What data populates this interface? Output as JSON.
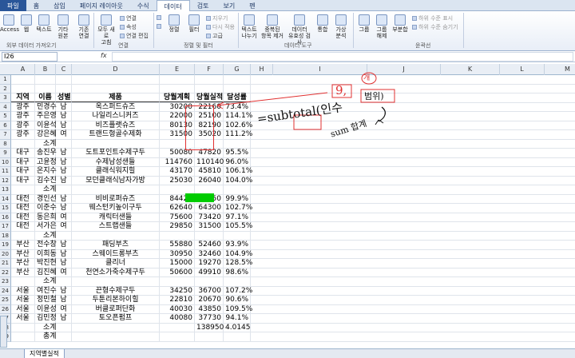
{
  "ribbon": {
    "tabs": [
      "파일",
      "홈",
      "삽입",
      "페이지 레이아웃",
      "수식",
      "데이터",
      "검토",
      "보기",
      "펜"
    ],
    "active_tab": "데이터",
    "buttons": {
      "access": "Access",
      "web": "웹",
      "text": "텍스트",
      "other_sources": "기타\n원본",
      "existing_conn": "기존\n연결",
      "refresh_all": "모두 새로\n고침",
      "conn": "연결",
      "props": "속성",
      "edit_links": "연결 편집",
      "sort_asc": "",
      "sort": "정렬",
      "filter": "필터",
      "clear": "지우기",
      "reapply": "다시 적용",
      "advanced": "고급",
      "text_to_cols": "텍스트\n나누기",
      "remove_dup": "중복된\n항목 제거",
      "validation": "데이터\n유효성 검사",
      "consolidate": "통합",
      "whatif": "가상\n분석",
      "group": "그룹",
      "ungroup": "그룹\n해제",
      "subtotal": "부분합",
      "show_detail": "하위 수준 표시",
      "hide_detail": "하위 수준 숨기기"
    },
    "groups": {
      "external": "외부 데이터 가져오기",
      "connections": "연결",
      "sortfilter": "정렬 및 필터",
      "datatools": "데이터 도구",
      "outline": "윤곽선"
    }
  },
  "formula_bar": {
    "name_box": "I26",
    "fx": "fx",
    "formula": ""
  },
  "columns": [
    "A",
    "B",
    "C",
    "D",
    "E",
    "F",
    "G",
    "H",
    "I",
    "J",
    "K",
    "L",
    "M",
    "N"
  ],
  "rows": [
    {
      "n": "1",
      "c": [
        "",
        "",
        "",
        "",
        "",
        "",
        ""
      ]
    },
    {
      "n": "2",
      "c": [
        "",
        "",
        "",
        "",
        "",
        "",
        ""
      ]
    },
    {
      "n": "3",
      "c": [
        "지역",
        "이름",
        "성별",
        "제품",
        "당월계획",
        "당월실적",
        "달성률"
      ]
    },
    {
      "n": "4",
      "c": [
        "광주",
        "민경수",
        "남",
        "옥스퍼드슈즈",
        "30200",
        "22160",
        "73.4%"
      ]
    },
    {
      "n": "5",
      "c": [
        "광주",
        "주은영",
        "남",
        "나일리스니커즈",
        "22000",
        "25100",
        "114.1%"
      ]
    },
    {
      "n": "6",
      "c": [
        "광주",
        "이윤석",
        "남",
        "비즈플랫슈즈",
        "80130",
        "82190",
        "102.6%"
      ]
    },
    {
      "n": "7",
      "c": [
        "광주",
        "강은혜",
        "여",
        "트랜드형골수제화",
        "31500",
        "35020",
        "111.2%"
      ]
    },
    {
      "n": "8",
      "c": [
        "",
        "소계",
        "",
        "",
        "",
        "",
        ""
      ]
    },
    {
      "n": "9",
      "c": [
        "대구",
        "송진우",
        "남",
        "도트포인트수제구두",
        "50080",
        "47820",
        "95.5%"
      ]
    },
    {
      "n": "10",
      "c": [
        "대구",
        "고윤정",
        "남",
        "수제남성샌들",
        "114760",
        "110140",
        "96.0%"
      ]
    },
    {
      "n": "11",
      "c": [
        "대구",
        "온지수",
        "남",
        "클래식워지힐",
        "43170",
        "45810",
        "106.1%"
      ]
    },
    {
      "n": "12",
      "c": [
        "대구",
        "김수진",
        "남",
        "모던클래식남자가방",
        "25030",
        "26040",
        "104.0%"
      ]
    },
    {
      "n": "13",
      "c": [
        "",
        "소계",
        "",
        "",
        "",
        "",
        ""
      ]
    },
    {
      "n": "14",
      "c": [
        "대전",
        "경인선",
        "남",
        "비비로퍼슈즈",
        "84420",
        "84350",
        "99.9%"
      ]
    },
    {
      "n": "15",
      "c": [
        "대전",
        "이준수",
        "남",
        "웨스턴키높이구두",
        "62640",
        "64300",
        "102.7%"
      ]
    },
    {
      "n": "16",
      "c": [
        "대전",
        "동은희",
        "여",
        "캐릭터샌들",
        "75600",
        "73420",
        "97.1%"
      ]
    },
    {
      "n": "17",
      "c": [
        "대전",
        "서가은",
        "여",
        "스트랩샌들",
        "29850",
        "31500",
        "105.5%"
      ]
    },
    {
      "n": "18",
      "c": [
        "",
        "소계",
        "",
        "",
        "",
        "",
        ""
      ]
    },
    {
      "n": "19",
      "c": [
        "부산",
        "전수창",
        "남",
        "패딩부츠",
        "55880",
        "52460",
        "93.9%"
      ]
    },
    {
      "n": "20",
      "c": [
        "부산",
        "이희동",
        "남",
        "스웨이드롱부츠",
        "30950",
        "32460",
        "104.9%"
      ]
    },
    {
      "n": "21",
      "c": [
        "부산",
        "박진현",
        "남",
        "클리너",
        "15000",
        "19270",
        "128.5%"
      ]
    },
    {
      "n": "22",
      "c": [
        "부산",
        "김진혜",
        "여",
        "천연소가죽수제구두",
        "50600",
        "49910",
        "98.6%"
      ]
    },
    {
      "n": "23",
      "c": [
        "",
        "소계",
        "",
        "",
        "",
        "",
        ""
      ]
    },
    {
      "n": "24",
      "c": [
        "서울",
        "여진수",
        "남",
        "끈형수제구두",
        "34250",
        "36700",
        "107.2%"
      ]
    },
    {
      "n": "25",
      "c": [
        "서울",
        "정민철",
        "남",
        "두툰리본하이힐",
        "22810",
        "20670",
        "90.6%"
      ]
    },
    {
      "n": "26",
      "c": [
        "서울",
        "이윤성",
        "여",
        "버클로퍼단화",
        "40030",
        "43850",
        "109.5%"
      ]
    },
    {
      "n": "27",
      "c": [
        "서울",
        "김민정",
        "남",
        "토오픈펌프",
        "40080",
        "37730",
        "94.1%"
      ]
    },
    {
      "n": "28",
      "c": [
        "",
        "소계",
        "",
        "",
        "",
        "138950",
        "4.0145"
      ]
    },
    {
      "n": "29",
      "c": [
        "",
        "총계",
        "",
        "",
        "",
        "",
        ""
      ]
    }
  ],
  "annotations": {
    "formula": "=subtotal(인수",
    "num_nine": "9,",
    "range_word": "범위)",
    "sum_note": "sum 합계",
    "circled": "개"
  },
  "sheet_tab": "지역별실적",
  "colors": {
    "file_tab": "#2a5699",
    "highlight_green": "#00cc00",
    "annotation_red": "#e03030",
    "header_bg": "#e9eef5"
  }
}
